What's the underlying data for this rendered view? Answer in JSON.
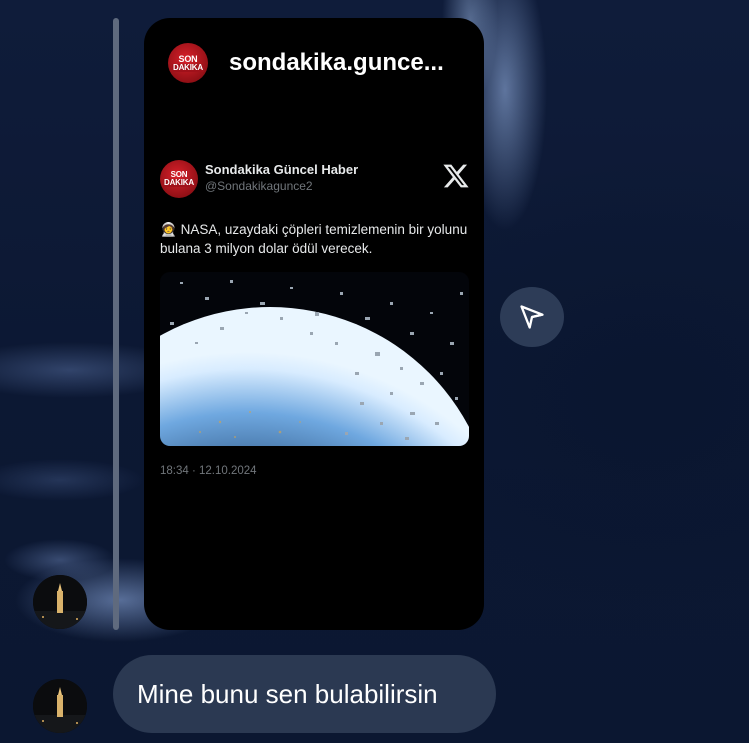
{
  "card": {
    "account_name": "sondakika.gunce...",
    "logo_top": "SON",
    "logo_bottom": "DAKIKA"
  },
  "tweet": {
    "author": "Sondakika Güncel Haber",
    "handle": "@Sondakikagunce2",
    "emoji": "🧑‍🚀",
    "text": "NASA, uzaydaki çöpleri temizlemenin bir yolunu bulana 3 milyon dolar ödül verecek.",
    "time": "18:34 · 12.10.2024",
    "image_icon": "earth-space-debris-image"
  },
  "share": {
    "icon": "send-icon"
  },
  "message": {
    "text": "Mine bunu sen bulabilirsin"
  },
  "colors": {
    "background": "#0e1a36",
    "card": "#000000",
    "bubble": "#2b3952",
    "brand_red": "#c41a22"
  }
}
